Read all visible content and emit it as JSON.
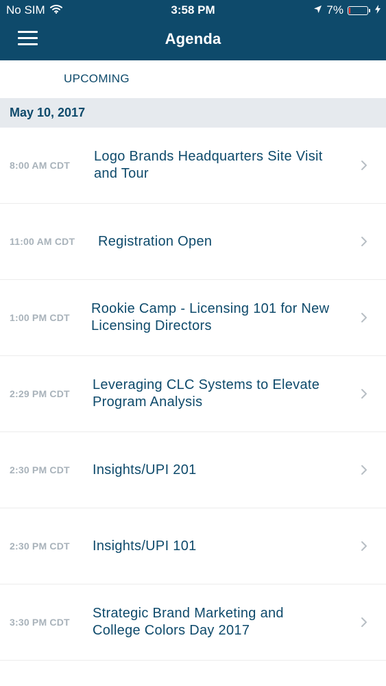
{
  "status_bar": {
    "carrier": "No SIM",
    "time": "3:58 PM",
    "battery": "7%",
    "battery_level": 0.07
  },
  "nav": {
    "title": "Agenda",
    "menu_icon": "hamburger-icon"
  },
  "tabs": {
    "upcoming": "UPCOMING"
  },
  "date_header": "May 10, 2017",
  "colors": {
    "header_bg": "#0e4a6b",
    "accent": "#0e4a6b",
    "time_text": "#a8b2ba",
    "section_bg": "#e6eaee",
    "battery_low": "#ff3b30"
  },
  "agenda": [
    {
      "time": "8:00 AM CDT",
      "title_line1": "Logo Brands Headquarters Site Visit",
      "title_line2": "and Tour"
    },
    {
      "time": "11:00 AM CDT",
      "title_line1": "Registration Open",
      "title_line2": ""
    },
    {
      "time": "1:00 PM CDT",
      "title_line1": "Rookie Camp - Licensing 101 for New",
      "title_line2": "Licensing Directors"
    },
    {
      "time": "2:29 PM CDT",
      "title_line1": "Leveraging CLC Systems to Elevate",
      "title_line2": "Program Analysis"
    },
    {
      "time": "2:30 PM CDT",
      "title_line1": "Insights/UPI 201",
      "title_line2": ""
    },
    {
      "time": "2:30 PM CDT",
      "title_line1": "Insights/UPI 101",
      "title_line2": ""
    },
    {
      "time": "3:30 PM CDT",
      "title_line1": "Strategic Brand Marketing and",
      "title_line2": "College Colors Day 2017"
    }
  ]
}
